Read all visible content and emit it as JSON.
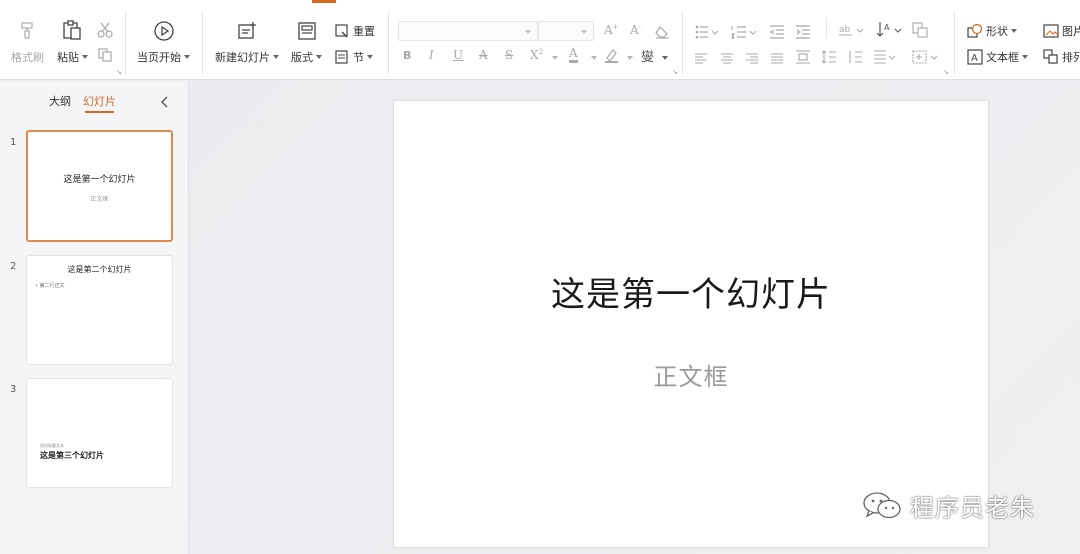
{
  "toolbar": {
    "format_painter": "格式刷",
    "paste": "粘贴",
    "from_current": "当页开始",
    "new_slide": "新建幻灯片",
    "layout": "版式",
    "reset": "重置",
    "section": "节",
    "font_name": "",
    "font_size": "",
    "shape": "形状",
    "textbox": "文本框",
    "picture": "图片",
    "arrange": "排列"
  },
  "sidebar": {
    "tab_outline": "大纲",
    "tab_slides": "幻灯片",
    "thumbnails": [
      {
        "number": "1",
        "title": "这是第一个幻灯片",
        "subtitle": "正文框"
      },
      {
        "number": "2",
        "title": "这是第二个幻灯片",
        "bullet": "• 第二行正文"
      },
      {
        "number": "3",
        "small_text": "测试标题文本",
        "title": "这是第三个幻灯片"
      }
    ]
  },
  "slide": {
    "title": "这是第一个幻灯片",
    "subtitle": "正文框"
  },
  "watermark": {
    "text": "程序员老朱"
  },
  "colors": {
    "accent": "#d2691e",
    "selected_border": "#e08a4e"
  }
}
